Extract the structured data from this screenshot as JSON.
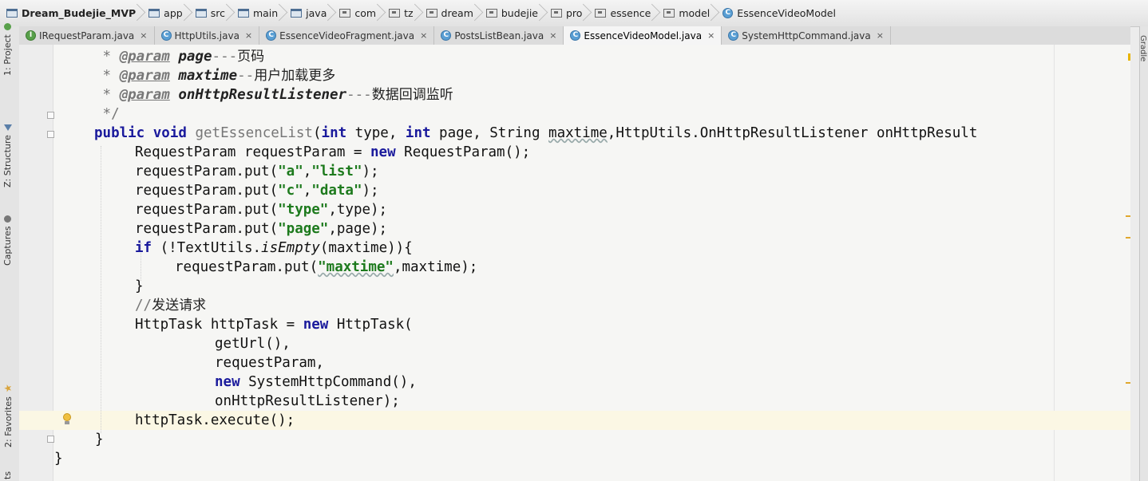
{
  "breadcrumb": [
    {
      "label": "Dream_Budejie_MVP",
      "icon": "module-icon"
    },
    {
      "label": "app",
      "icon": "module-icon"
    },
    {
      "label": "src",
      "icon": "folder-icon"
    },
    {
      "label": "main",
      "icon": "folder-icon"
    },
    {
      "label": "java",
      "icon": "folder-icon"
    },
    {
      "label": "com",
      "icon": "package-icon"
    },
    {
      "label": "tz",
      "icon": "package-icon"
    },
    {
      "label": "dream",
      "icon": "package-icon"
    },
    {
      "label": "budejie",
      "icon": "package-icon"
    },
    {
      "label": "pro",
      "icon": "package-icon"
    },
    {
      "label": "essence",
      "icon": "package-icon"
    },
    {
      "label": "model",
      "icon": "package-icon"
    },
    {
      "label": "EssenceVideoModel",
      "icon": "class-icon"
    }
  ],
  "tabs": [
    {
      "label": "IRequestParam.java",
      "icon": "interface-icon",
      "active": false
    },
    {
      "label": "HttpUtils.java",
      "icon": "class-icon",
      "active": false
    },
    {
      "label": "EssenceVideoFragment.java",
      "icon": "class-icon",
      "active": false
    },
    {
      "label": "PostsListBean.java",
      "icon": "class-icon",
      "active": false
    },
    {
      "label": "EssenceVideoModel.java",
      "icon": "class-icon",
      "active": true
    },
    {
      "label": "SystemHttpCommand.java",
      "icon": "class-icon",
      "active": false
    }
  ],
  "tab_close": "×",
  "tool_windows": {
    "project": "1: Project",
    "structure": "Z: Structure",
    "captures": "Captures",
    "favorites": "2: Favorites",
    "bottom_partial": "ts",
    "gradle": "Gradle"
  },
  "code": {
    "l1_star": " * ",
    "l1_tag": "@param",
    "l1_name": "page",
    "l1_dash": "---",
    "l1_text": "页码",
    "l2_star": " * ",
    "l2_tag": "@param",
    "l2_name": "maxtime",
    "l2_dash": "--",
    "l2_text": "用户加载更多",
    "l3_star": " * ",
    "l3_tag": "@param",
    "l3_name": "onHttpResultListener",
    "l3_dash": "---",
    "l3_text": "数据回调监听",
    "l4": " */",
    "l5_kw1": "public",
    "l5_kw2": "void",
    "l5_method": "getEssenceList",
    "l5_p1": "(",
    "l5_kw3": "int",
    "l5_p2": " type, ",
    "l5_kw4": "int",
    "l5_p3": " page, String ",
    "l5_p4": "maxtime",
    "l5_p5": ",HttpUtils.OnHttpResultListener onHttpResult",
    "l6_a": "RequestParam requestParam = ",
    "l6_kw": "new",
    "l6_b": " RequestParam();",
    "l7_a": "requestParam.put(",
    "l7_s1": "\"a\"",
    "l7_b": ",",
    "l7_s2": "\"list\"",
    "l7_c": ");",
    "l8_a": "requestParam.put(",
    "l8_s1": "\"c\"",
    "l8_b": ",",
    "l8_s2": "\"data\"",
    "l8_c": ");",
    "l9_a": "requestParam.put(",
    "l9_s1": "\"type\"",
    "l9_b": ",type);",
    "l10_a": "requestParam.put(",
    "l10_s1": "\"page\"",
    "l10_b": ",page);",
    "l11_kw": "if",
    "l11_a": " (!TextUtils.",
    "l11_it": "isEmpty",
    "l11_b": "(maxtime)){",
    "l12_a": "requestParam.put(",
    "l12_s1": "\"maxtime\"",
    "l12_b": ",maxtime);",
    "l13": "}",
    "l14_a": "//",
    "l14_b": "发送请求",
    "l15_a": "HttpTask httpTask = ",
    "l15_kw": "new",
    "l15_b": " HttpTask(",
    "l16": "getUrl(),",
    "l17": "requestParam,",
    "l18_kw": "new",
    "l18_b": " SystemHttpCommand(),",
    "l19": "onHttpResultListener);",
    "l20": "httpTask.execute();",
    "l21": "}",
    "l22": "}"
  }
}
